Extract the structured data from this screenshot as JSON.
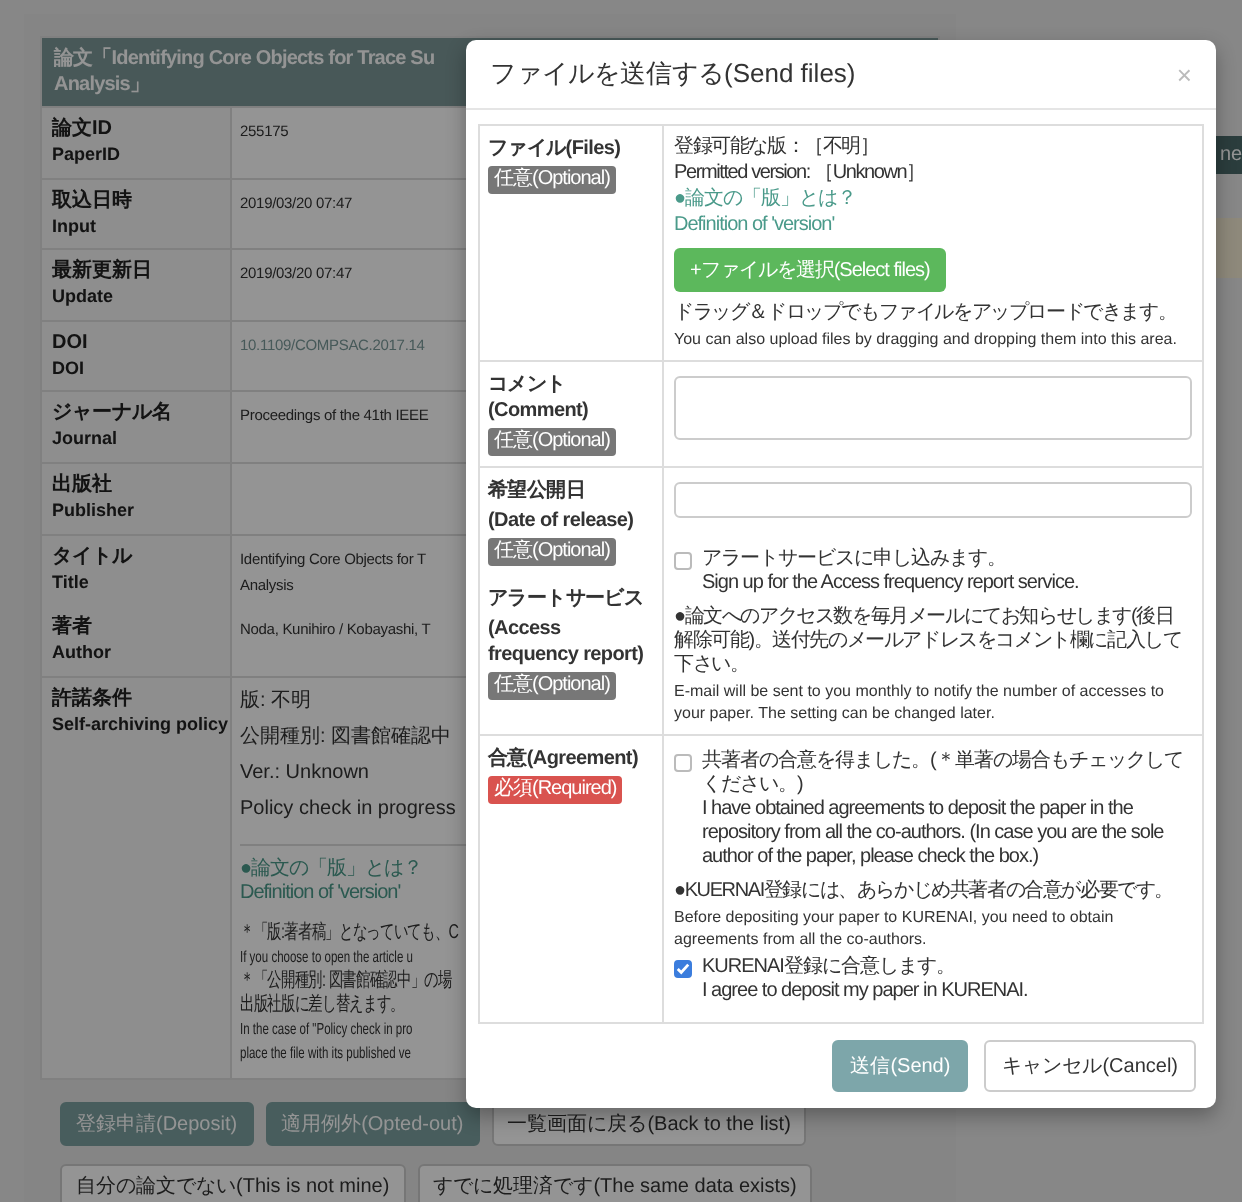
{
  "page": {
    "title_lines": [
      "論文「Identifying Core Objects for Trace Su",
      "Analysis」"
    ],
    "fields": [
      {
        "label_ja": "論文ID",
        "label_en": "PaperID",
        "kind": "text",
        "value": [
          "255175"
        ]
      },
      {
        "label_ja": "取込日時",
        "label_en": "Input",
        "kind": "text",
        "value": [
          "2019/03/20 07:47"
        ]
      },
      {
        "label_ja": "最新更新日",
        "label_en": "Update",
        "kind": "text",
        "value": [
          "2019/03/20 07:47"
        ]
      },
      {
        "label_ja": "DOI",
        "label_en": "DOI",
        "kind": "link",
        "value": [
          "10.1109/COMPSAC.2017.14"
        ]
      },
      {
        "label_ja": "ジャーナル名",
        "label_en": "Journal",
        "kind": "text",
        "value": [
          "Proceedings of the 41th IEEE"
        ]
      },
      {
        "label_ja": "出版社",
        "label_en": "Publisher"
      },
      {
        "label_ja": "タイトル",
        "label_en": "Title",
        "kind": "text",
        "value": [
          "Identifying Core Objects for T",
          "Analysis"
        ]
      },
      {
        "label_ja": "著者",
        "label_en": "Author",
        "kind": "text",
        "value": [
          "Noda, Kunihiro / Kobayashi, T"
        ]
      }
    ],
    "policy": {
      "label_ja": "許諾条件",
      "label_en": "Self-archiving policy",
      "lines": [
        "版: 不明",
        "公開種別: 図書館確認中",
        "Ver.: Unknown",
        "Policy check in progress"
      ],
      "links": [
        "●論文の「版」とは？",
        "Definition of 'version'"
      ],
      "notes": [
        {
          "kind": "ja",
          "text": "＊「版:著者稿」となっていても、C"
        },
        {
          "kind": "en",
          "text": "If you choose to open the article u"
        },
        {
          "kind": "ja",
          "text": "＊「公開種別: 図書館確認中」の場"
        },
        {
          "kind": "ja",
          "text": "出版社版に差し替えます。"
        },
        {
          "kind": "en",
          "text": "In the case of \"Policy check in pro"
        },
        {
          "kind": "en",
          "text": "place the file with its published ve"
        }
      ]
    },
    "button_rows": [
      [
        {
          "label": "登録申請(Deposit)",
          "kind": "primary"
        },
        {
          "label": "適用例外(Opted-out)",
          "kind": "primary"
        },
        {
          "label": "一覧画面に戻る(Back to the list)",
          "kind": "default"
        }
      ],
      [
        {
          "label": "自分の論文でない(This is not mine)",
          "kind": "default"
        },
        {
          "label": "すでに処理済です(The same data exists)",
          "kind": "default"
        }
      ]
    ]
  },
  "side": {
    "button": "ne"
  },
  "modal": {
    "title": "ファイルを送信する(Send files)",
    "close": "×",
    "sections": [
      {
        "labels": [
          {
            "title": [
              "ファイル(Files)"
            ],
            "badge": "任意(Optional)",
            "kind": "optional"
          }
        ],
        "content": [
          {
            "kind": "text",
            "text": "登録可能な版：［不明］"
          },
          {
            "kind": "text",
            "text": "Permitted version: ［Unknown］"
          },
          {
            "kind": "link",
            "text": "●論文の「版」とは？"
          },
          {
            "kind": "link",
            "text": "Definition of 'version'"
          },
          {
            "kind": "file_button",
            "text": "+ファイルを選択(Select files)"
          },
          {
            "kind": "text",
            "text": "ドラッグ＆ドロップでもファイルをアップロードできます。"
          },
          {
            "kind": "fine",
            "text": "You can also upload files by dragging and dropping them into this area."
          }
        ]
      },
      {
        "labels": [
          {
            "title": [
              "コメント(Comment)"
            ],
            "badge": "任意(Optional)",
            "kind": "optional"
          }
        ],
        "content": [
          {
            "kind": "textarea"
          }
        ]
      },
      {
        "labels": [
          {
            "title": [
              "希望公開日",
              "(Date of release)"
            ],
            "badge": "任意(Optional)",
            "kind": "optional"
          },
          {
            "title": [
              "アラートサービス",
              "(Access frequency report)"
            ],
            "badge": "任意(Optional)",
            "kind": "optional"
          }
        ],
        "content": [
          {
            "kind": "input"
          },
          {
            "kind": "checkbox",
            "checked": false,
            "lines": [
              "アラートサービスに申し込みます。",
              "Sign up for the Access frequency report service."
            ]
          },
          {
            "kind": "text",
            "text": "●論文へのアクセス数を毎月メールにてお知らせします(後日解除可能)。送付先のメールアドレスをコメント欄に記入して下さい。"
          },
          {
            "kind": "fine",
            "text": "E-mail will be sent to you monthly to notify the number of accesses to your paper. The setting can be changed later."
          }
        ]
      },
      {
        "labels": [
          {
            "title": [
              "合意(Agreement)"
            ],
            "badge": "必須(Required)",
            "kind": "required"
          }
        ],
        "content": [
          {
            "kind": "checkbox",
            "checked": false,
            "lines": [
              "共著者の合意を得ました。(＊単著の場合もチェックしてください。)",
              "I have obtained agreements to deposit the paper in the repository from all the co-authors. (In case you are the sole author of the paper, please check the box.)"
            ]
          },
          {
            "kind": "text",
            "text": "●KUERNAI登録には、あらかじめ共著者の合意が必要です。"
          },
          {
            "kind": "fine",
            "text": "Before depositing your paper to KURENAI, you need to obtain agreements from all the co-authors."
          },
          {
            "kind": "checkbox",
            "checked": true,
            "lines": [
              "KURENAI登録に合意します。",
              "I agree to deposit my paper in KURENAI."
            ]
          }
        ]
      }
    ],
    "footer": [
      {
        "label": "送信(Send)",
        "kind": "primary",
        "disabled": true
      },
      {
        "label": "キャンセル(Cancel)",
        "kind": "default",
        "disabled": false
      }
    ]
  }
}
